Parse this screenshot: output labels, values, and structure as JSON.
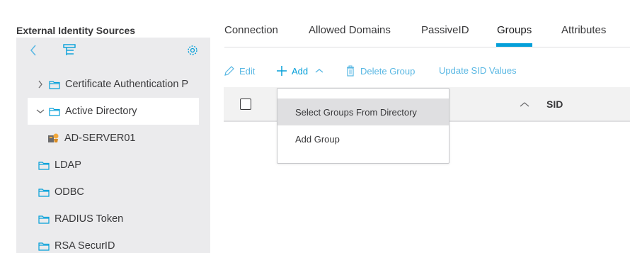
{
  "sidebar": {
    "title": "External Identity Sources",
    "tree": [
      {
        "label": "Certificate Authentication P",
        "expanded": false
      },
      {
        "label": "Active Directory",
        "expanded": true,
        "selected": true
      },
      {
        "label": "AD-SERVER01"
      },
      {
        "label": "LDAP"
      },
      {
        "label": "ODBC"
      },
      {
        "label": "RADIUS Token"
      },
      {
        "label": "RSA SecurID"
      }
    ]
  },
  "tabs": [
    {
      "label": "Connection"
    },
    {
      "label": "Allowed Domains"
    },
    {
      "label": "PassiveID"
    },
    {
      "label": "Groups",
      "active": true
    },
    {
      "label": "Attributes"
    }
  ],
  "actions": {
    "edit": "Edit",
    "add": "Add",
    "delete_group": "Delete Group",
    "update_sid": "Update SID Values"
  },
  "table": {
    "columns": [
      "SID"
    ]
  },
  "dropdown": {
    "items": [
      "Select Groups From Directory",
      "Add Group"
    ]
  },
  "colors": {
    "accent": "#049fd9",
    "link": "#58b7e3",
    "sidebar_bg": "#ebebed"
  }
}
